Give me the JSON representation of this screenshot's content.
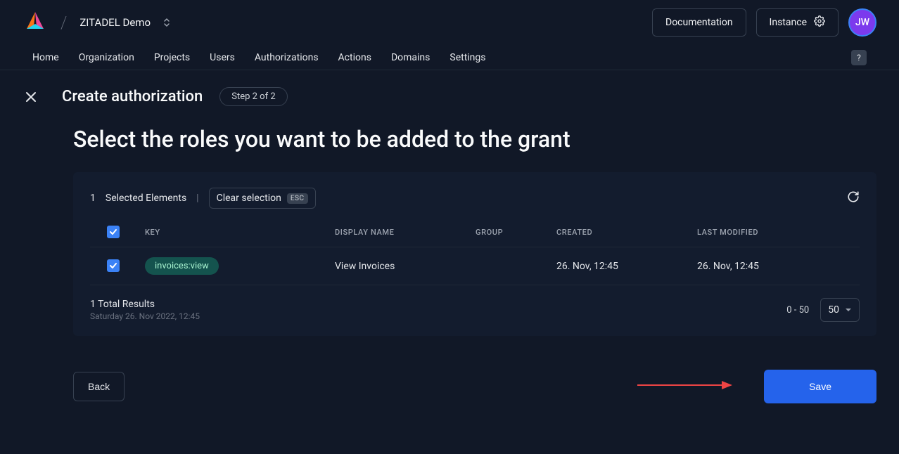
{
  "header": {
    "org_name": "ZITADEL Demo",
    "documentation": "Documentation",
    "instance": "Instance",
    "avatar_initials": "JW"
  },
  "nav": {
    "items": [
      "Home",
      "Organization",
      "Projects",
      "Users",
      "Authorizations",
      "Actions",
      "Domains",
      "Settings"
    ],
    "help": "?"
  },
  "page": {
    "title": "Create authorization",
    "step": "Step 2 of 2",
    "subtitle": "Select the roles you want to be added to the grant"
  },
  "selection": {
    "count": "1",
    "label": "Selected Elements",
    "clear": "Clear selection",
    "esc": "ESC"
  },
  "table": {
    "columns": {
      "key": "KEY",
      "display_name": "DISPLAY NAME",
      "group": "GROUP",
      "created": "CREATED",
      "modified": "LAST MODIFIED"
    },
    "rows": [
      {
        "key": "invoices:view",
        "display_name": "View Invoices",
        "group": "",
        "created": "26. Nov, 12:45",
        "modified": "26. Nov, 12:45"
      }
    ],
    "footer": {
      "total": "1 Total Results",
      "timestamp": "Saturday 26. Nov 2022, 12:45",
      "range": "0 - 50",
      "page_size": "50"
    }
  },
  "actions": {
    "back": "Back",
    "save": "Save"
  }
}
